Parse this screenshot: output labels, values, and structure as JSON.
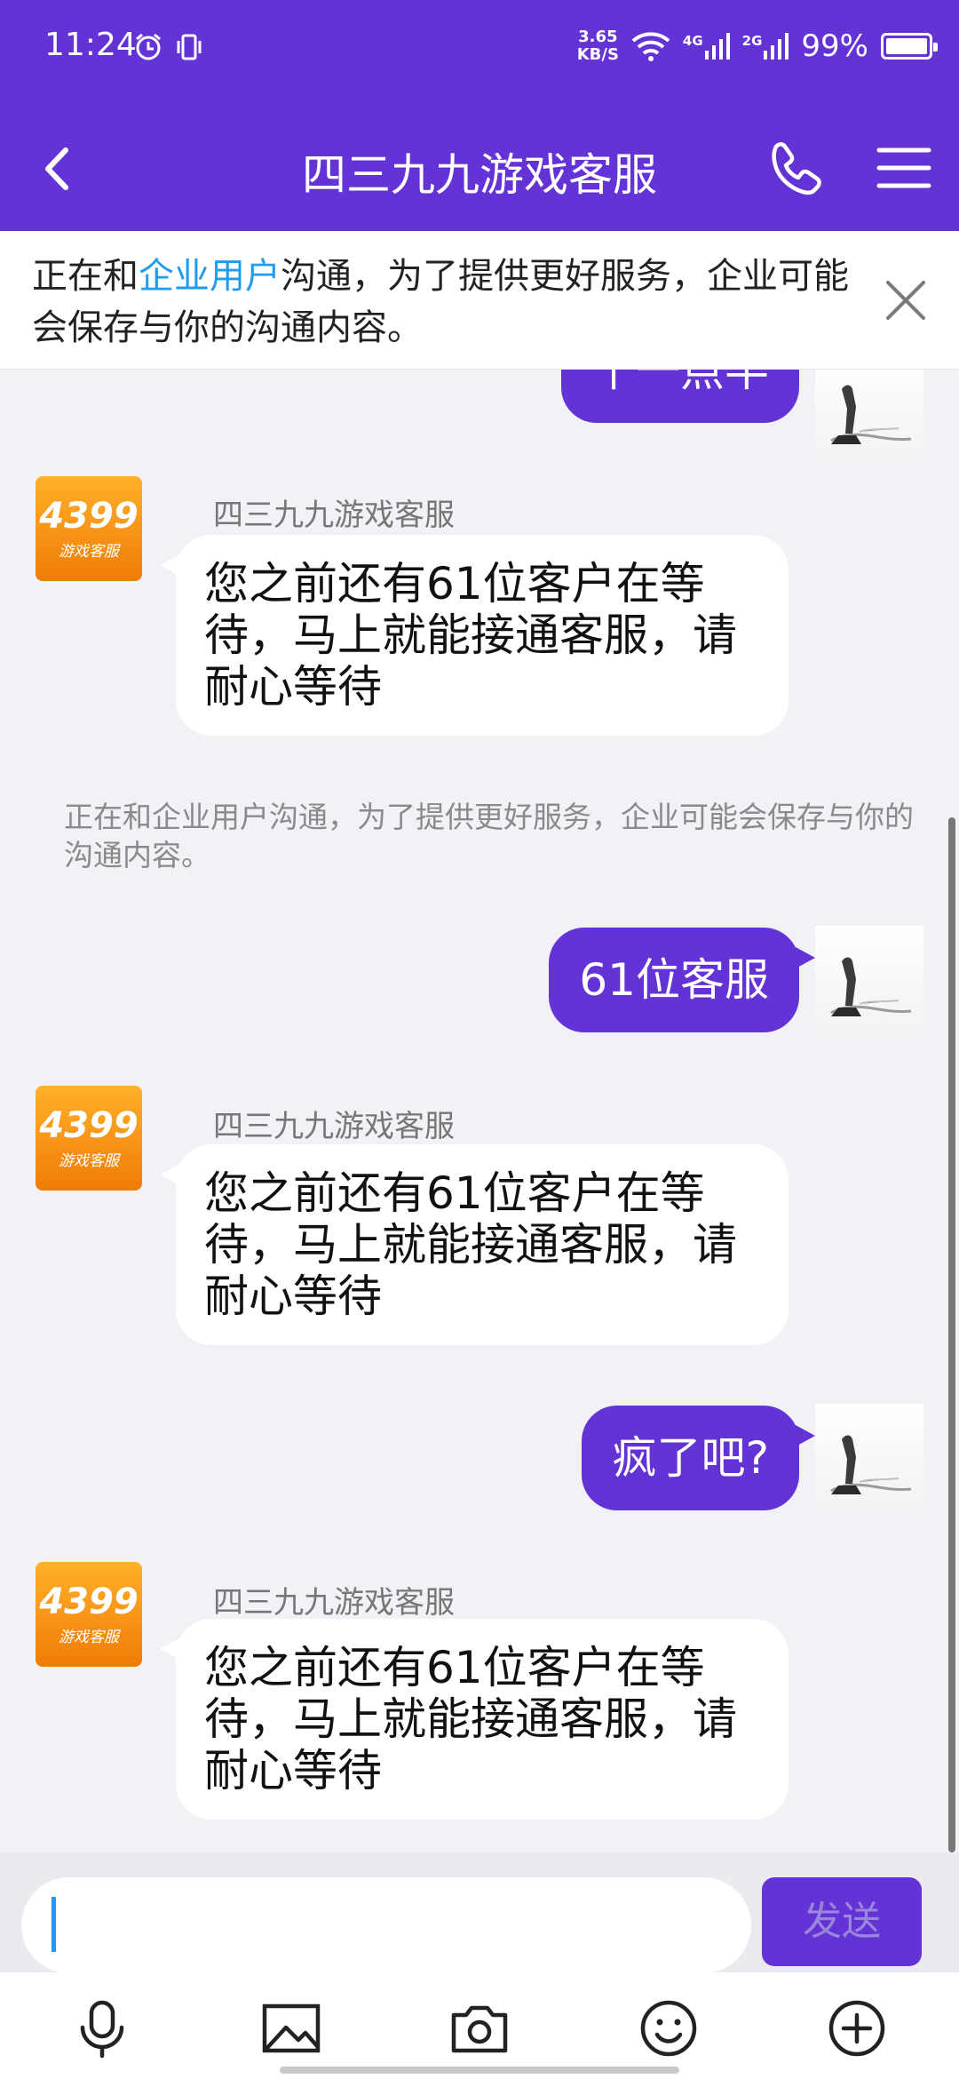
{
  "status_bar": {
    "time": "11:24",
    "net_speed_value": "3.65",
    "net_speed_unit": "KB/S",
    "signal_1_label": "4G",
    "signal_2_label": "2G",
    "battery": "99%",
    "battery_level": 0.99
  },
  "header": {
    "title": "四三九九游戏客服",
    "back_icon": "chevron-left-icon",
    "phone_icon": "phone-icon",
    "menu_icon": "menu-icon"
  },
  "notice": {
    "text_before": "正在和",
    "link_text": "企业用户",
    "text_after": "沟通，为了提供更好服务，企业可能会保存与你的沟通内容。"
  },
  "messages": {
    "m1": {
      "text": "十一点半"
    },
    "m2": {
      "sender": "四三九九游戏客服",
      "text": "您之前还有61位客户在等待，马上就能接通客服，请耐心等待"
    },
    "sys": {
      "text": "正在和企业用户沟通，为了提供更好服务，企业可能会保存与你的沟通内容。"
    },
    "m3": {
      "text": "61位客服"
    },
    "m4": {
      "sender": "四三九九游戏客服",
      "text": "您之前还有61位客户在等待，马上就能接通客服，请耐心等待"
    },
    "m5": {
      "text": "疯了吧?"
    },
    "m6": {
      "sender": "四三九九游戏客服",
      "text": "您之前还有61位客户在等待，马上就能接通客服，请耐心等待"
    }
  },
  "avatar_4399": {
    "number": "4399",
    "subtitle": "游戏客服"
  },
  "composer": {
    "value": "",
    "send_label": "发送"
  },
  "toolbar": {
    "icons": [
      "microphone-icon",
      "image-icon",
      "camera-icon",
      "emoji-icon",
      "plus-icon"
    ]
  },
  "colors": {
    "brand": "#6433d6",
    "link": "#1e9df0",
    "avatar_orange": "#f5920f"
  }
}
